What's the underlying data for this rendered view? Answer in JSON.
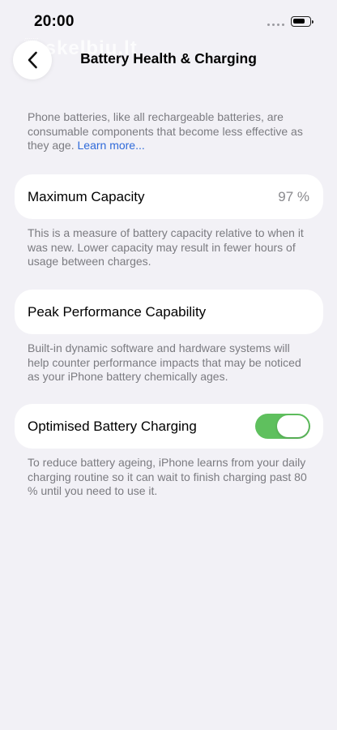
{
  "status_bar": {
    "time": "20:00",
    "battery_level": 0.8
  },
  "header": {
    "title": "Battery Health & Charging",
    "back_icon": "chevron-left-icon",
    "watermark": "skelbiu.lt"
  },
  "intro": {
    "text": "Phone batteries, like all rechargeable batteries, are consumable components that become less effective as they age. ",
    "link_label": "Learn more..."
  },
  "maximum_capacity": {
    "label": "Maximum Capacity",
    "value": "97 %",
    "description": "This is a measure of battery capacity relative to when it was new. Lower capacity may result in fewer hours of usage between charges."
  },
  "peak_performance": {
    "label": "Peak Performance Capability",
    "description": "Built-in dynamic software and hardware systems will help counter performance impacts that may be noticed as your iPhone battery chemically ages."
  },
  "optimised_charging": {
    "label": "Optimised Battery Charging",
    "enabled": true,
    "description": "To reduce battery ageing, iPhone learns from your daily charging routine so it can wait to finish charging past 80 % until you need to use it."
  },
  "colors": {
    "background": "#f2f1f6",
    "card": "#ffffff",
    "link": "#2f6ad9",
    "toggle_on": "#5fc05e",
    "secondary_text": "#7b7b80"
  }
}
